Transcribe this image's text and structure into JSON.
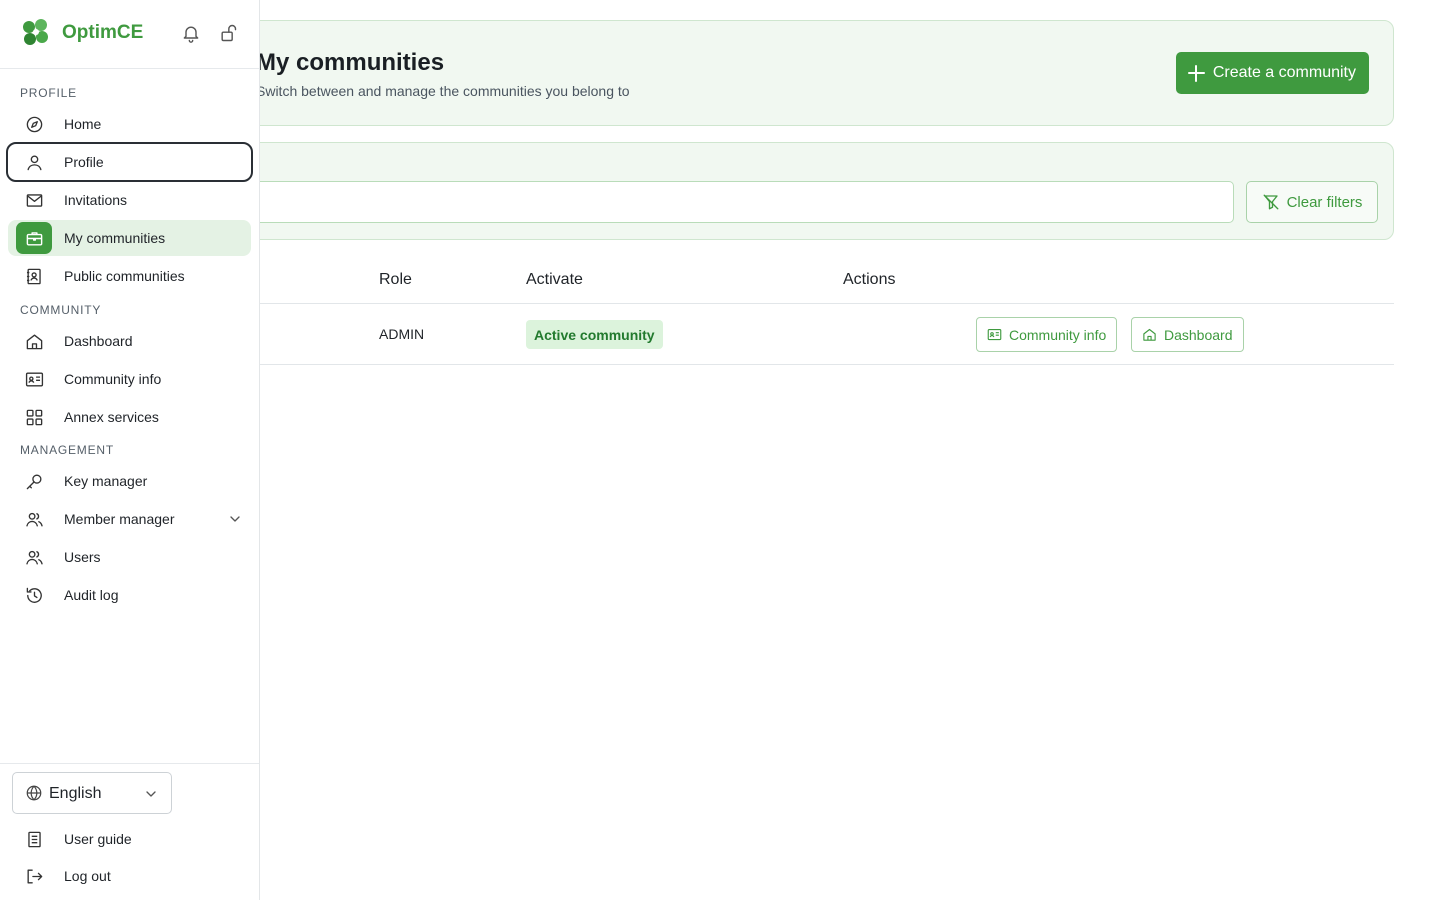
{
  "app": {
    "name": "OptimCE"
  },
  "header": {
    "title": "My communities",
    "subtitle": "Switch between and manage the communities you belong to",
    "create_button": "Create a community"
  },
  "filters": {
    "search_value": "",
    "clear_button": "Clear filters"
  },
  "table": {
    "columns": {
      "role": "Role",
      "activate": "Activate",
      "actions": "Actions"
    },
    "rows": [
      {
        "role": "ADMIN",
        "status": "Active community",
        "action_info": "Community info",
        "action_dashboard": "Dashboard"
      }
    ]
  },
  "sidebar": {
    "sections": {
      "profile": "PROFILE",
      "community": "COMMUNITY",
      "management": "MANAGEMENT"
    },
    "items": [
      {
        "label": "Home",
        "icon": "compass-icon"
      },
      {
        "label": "Profile",
        "icon": "user-icon"
      },
      {
        "label": "Invitations",
        "icon": "mail-icon"
      },
      {
        "label": "My communities",
        "icon": "briefcase-icon"
      },
      {
        "label": "Public communities",
        "icon": "contact-book-icon"
      },
      {
        "label": "Dashboard",
        "icon": "house-icon"
      },
      {
        "label": "Community info",
        "icon": "id-card-icon"
      },
      {
        "label": "Annex services",
        "icon": "grid-icon"
      },
      {
        "label": "Key manager",
        "icon": "key-icon"
      },
      {
        "label": "Member manager",
        "icon": "members-icon"
      },
      {
        "label": "Users",
        "icon": "users-icon"
      },
      {
        "label": "Audit log",
        "icon": "history-icon"
      }
    ],
    "language": "English",
    "footer": {
      "user_guide": "User guide",
      "logout": "Log out"
    }
  },
  "colors": {
    "brand": "#3f9a3f",
    "active_bg": "#e4f2e4",
    "card_bg": "#f1f8f1",
    "badge_bg": "#dcf3dc"
  }
}
